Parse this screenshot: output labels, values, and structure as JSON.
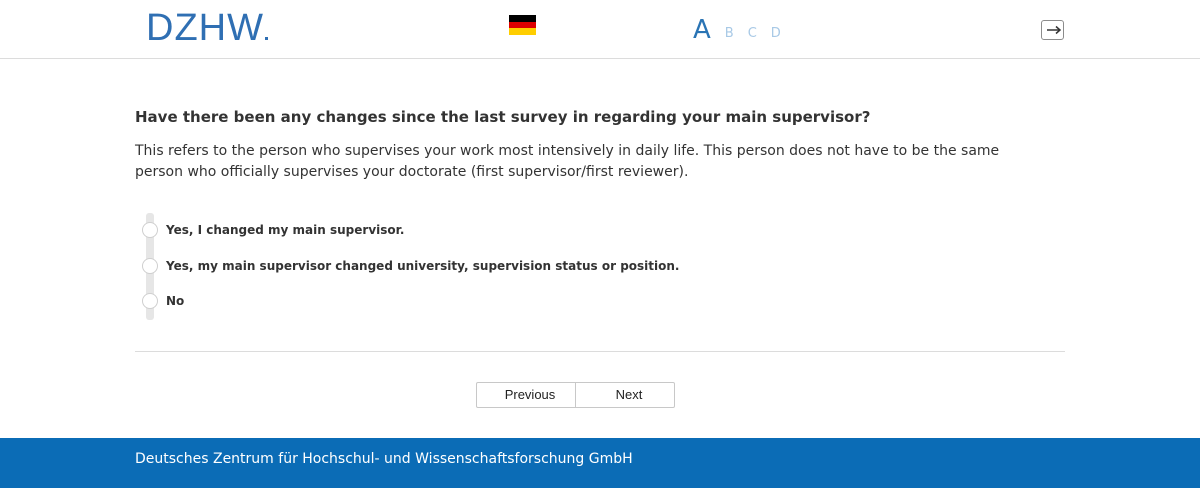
{
  "header": {
    "logo_text": "DZHW",
    "language_flag": "german-flag-icon",
    "font_size_options": [
      "A",
      "B",
      "C",
      "D"
    ],
    "logout_icon": "logout-icon"
  },
  "main": {
    "question": "Have there been any changes since the last survey in regarding your main supervisor?",
    "description": "This refers to the person who supervises your work most intensively in daily life. This person does not have to be the same person who officially supervises your doctorate (first supervisor/first reviewer).",
    "options": [
      {
        "label": "Yes, I changed my main supervisor."
      },
      {
        "label": "Yes, my main supervisor changed university, supervision status or position."
      },
      {
        "label": "No"
      }
    ],
    "buttons": {
      "previous": "Previous",
      "next": "Next"
    }
  },
  "footer": {
    "text": "Deutsches Zentrum für Hochschul- und Wissenschaftsforschung GmbH"
  },
  "colors": {
    "brand_blue": "#2f6fb3",
    "footer_blue": "#0b6cb6",
    "font_size_inactive": "#a8c9e6"
  }
}
